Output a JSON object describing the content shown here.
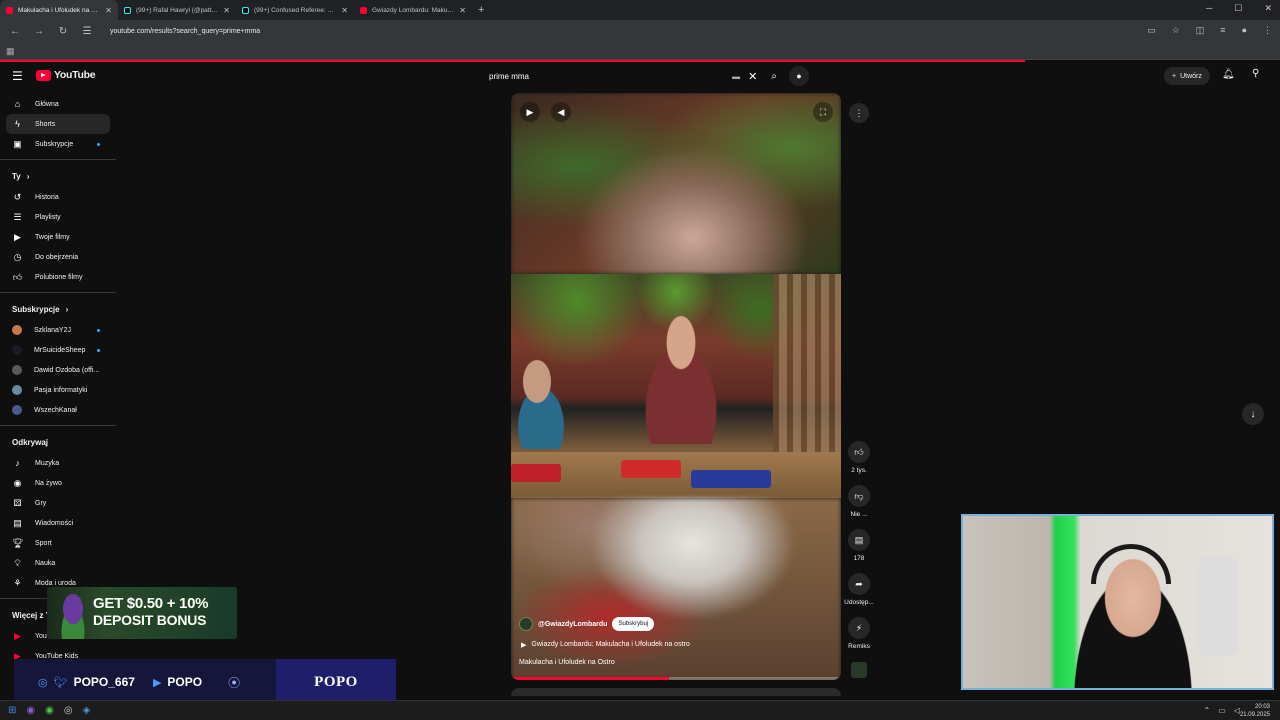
{
  "browser": {
    "tabs": [
      {
        "title": "Makulacha i Ufoludek na Ostro",
        "icon": "youtube-icon",
        "active": true
      },
      {
        "title": "(99+) Rafal Hawryl (@patt_offi",
        "icon": "tiktok-icon",
        "active": false
      },
      {
        "title": "(99+) Confused Referee: A Sho",
        "icon": "tiktok-icon",
        "active": false
      },
      {
        "title": "Gwiazdy Lombardu: Makulach",
        "icon": "youtube-icon",
        "active": false
      }
    ],
    "new_tab": "+",
    "url": "youtube.com/results?search_query=prime+mma",
    "accent": "#ff0033"
  },
  "header": {
    "logo": "YouTube",
    "search_query": "prime mma",
    "create_label": "Utwórz"
  },
  "sidebar": {
    "main": [
      {
        "label": "Główna",
        "icon": "home-icon",
        "active": false
      },
      {
        "label": "Shorts",
        "icon": "shorts-icon",
        "active": true
      },
      {
        "label": "Subskrypcje",
        "icon": "subscriptions-icon",
        "active": false,
        "dot": true
      }
    ],
    "you_heading": "Ty",
    "you": [
      {
        "label": "Historia",
        "icon": "history-icon"
      },
      {
        "label": "Playlisty",
        "icon": "playlists-icon"
      },
      {
        "label": "Twoje filmy",
        "icon": "your-videos-icon"
      },
      {
        "label": "Do obejrzenia",
        "icon": "watch-later-icon"
      },
      {
        "label": "Polubione filmy",
        "icon": "liked-icon"
      }
    ],
    "subs_heading": "Subskrypcje",
    "subs": [
      {
        "label": "SzklanaY2J",
        "color": "#c47a4a",
        "dot": true
      },
      {
        "label": "MrSuicideSheep",
        "color": "#1a1a2a",
        "dot": true
      },
      {
        "label": "Dawid Ozdoba (offi...",
        "color": "#5a5a5a",
        "dot": false
      },
      {
        "label": "Pasja informatyki",
        "color": "#6a8aa0",
        "dot": false
      },
      {
        "label": "WszechKanał",
        "color": "#4a5a8a",
        "dot": false
      }
    ],
    "explore_heading": "Odkrywaj",
    "explore": [
      {
        "label": "Muzyka",
        "icon": "music-icon"
      },
      {
        "label": "Na żywo",
        "icon": "live-icon"
      },
      {
        "label": "Gry",
        "icon": "gaming-icon"
      },
      {
        "label": "Wiadomości",
        "icon": "news-icon"
      },
      {
        "label": "Sport",
        "icon": "sport-icon"
      },
      {
        "label": "Nauka",
        "icon": "learning-icon"
      },
      {
        "label": "Moda i uroda",
        "icon": "fashion-icon"
      }
    ],
    "more_heading": "Więcej z Y",
    "more": [
      {
        "label": "You",
        "icon": "youtube-premium-icon"
      },
      {
        "label": "YouTube Kids",
        "icon": "youtube-kids-icon"
      }
    ]
  },
  "short": {
    "channel": "@GwiazdyLombardu",
    "subscribe_label": "Subskrybuj",
    "song": "Gwiazdy Lombardu: Makulacha i Ufoludek na ostro",
    "title": "Makulacha i Ufoludek na Ostro",
    "progress": 0.48
  },
  "actions": {
    "likes": "2 tys.",
    "dislike": "Nie ...",
    "comments": "178",
    "share": "Udostęp...",
    "remix": "Remiks"
  },
  "overlay": {
    "promo_line1": "GET $0.50 + 10%",
    "promo_line2": "DEPOSIT BONUS",
    "handle": "POPO_667",
    "youtube_handle": "POPO",
    "brand": "POPO"
  },
  "taskbar": {
    "time": "20:03",
    "date": "21.09.2025"
  }
}
